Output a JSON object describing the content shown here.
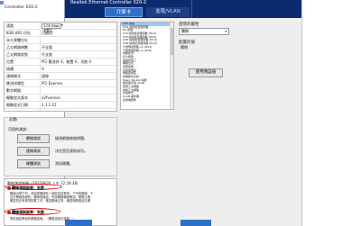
{
  "background_window": {
    "line1": "",
    "line2": "Controller 020-2"
  },
  "dialog": {
    "title": "Realtek Ethernet Controller 020-2",
    "tabs": [
      {
        "label": "介面卡"
      },
      {
        "label": "進階/VLAN"
      }
    ]
  },
  "info_panel": {
    "rows": [
      {
        "key": "速度",
        "value": "1.00 Gbps 全雙工"
      },
      {
        "key": "IEEE 802 位址",
        "value": "已啟用"
      },
      {
        "key": "永久實體位址",
        "value": ""
      },
      {
        "key": "乙太網路幀數",
        "value": "不支援"
      },
      {
        "key": "乙太網路狀態",
        "value": "不支援"
      },
      {
        "key": "位置",
        "value": "PCI 匯流排 4，裝置 0，功能 0"
      },
      {
        "key": "插槽",
        "value": "A"
      },
      {
        "key": "連線模式",
        "value": "連線"
      },
      {
        "key": "匯流排類型",
        "value": "PCI Express"
      },
      {
        "key": "數字網路",
        "value": ""
      },
      {
        "key": "驅動程式版本",
        "value": "e2fversion"
      },
      {
        "key": "驅動程式日期",
        "value": "1.1.1.21"
      }
    ]
  },
  "property_list": {
    "items": [
      "ARP 卸載",
      "IPv4 總和檢查碼卸載",
      "NS 卸載",
      "TCP 總和檢查碼卸載 (IPv4)",
      "TCP 總和檢查碼卸載 (IPv6)",
      "UDP 總和檢查碼卸載 (IPv4)",
      "UDP 總和檢查碼卸載 (IPv6)",
      "大量傳送卸載 v2 (IPv4)",
      "大量傳送卸載 v2 (IPv6)",
      "中斷節流",
      "巨大框架",
      "速度和雙工",
      "網路位址",
      "流量控制",
      "接收緩衝區",
      "傳輸緩衝區",
      "喚醒模式比對",
      "Magic Packet 喚醒",
      "優先順序與 VLAN",
      "節能乙太網路",
      "綠色乙太網路",
      "省電模式",
      "VLAN 識別碼",
      "接收端調整"
    ],
    "selected_index": 0
  },
  "right_panel": {
    "label_property": "進階的屬性",
    "select_value": "關閉",
    "label_status": "配置的值",
    "status_value": "關閉",
    "reset_button": "使用預設值"
  },
  "test_group": {
    "title": "診斷",
    "subtitle": "可用的測試：",
    "buttons": [
      {
        "label": "纜線測試",
        "desc": "檢測網路線路問題。"
      },
      {
        "label": "連線測試",
        "desc": "決定是否連結成功。"
      },
      {
        "label": "硬體測試",
        "desc": "測試硬體。"
      }
    ]
  },
  "results": {
    "header": "最後測試結果（2022/9/26 上午 12:28:38）",
    "items": [
      {
        "status": "纜線測試結果：失敗",
        "lines": [
          "纜線出現下列：或偵測纜線有一個區段或異常。下列的纜線：下",
          "位於纜線連線的。纜線連線處。會將網路纜線確認。開關正確",
          "確認是否有異常配置工作。確認纜線正常。確認相關連接正確"
        ]
      },
      {
        "status": "纜線測試結果：失敗",
        "lines": [
          "測試連結等級的網路連線。（網路連接已建構。）"
        ]
      }
    ]
  },
  "colors": {
    "title_bar": "#0b2b6f",
    "tab_active": "#2f6fc6",
    "annotation_red": "#d90000"
  }
}
